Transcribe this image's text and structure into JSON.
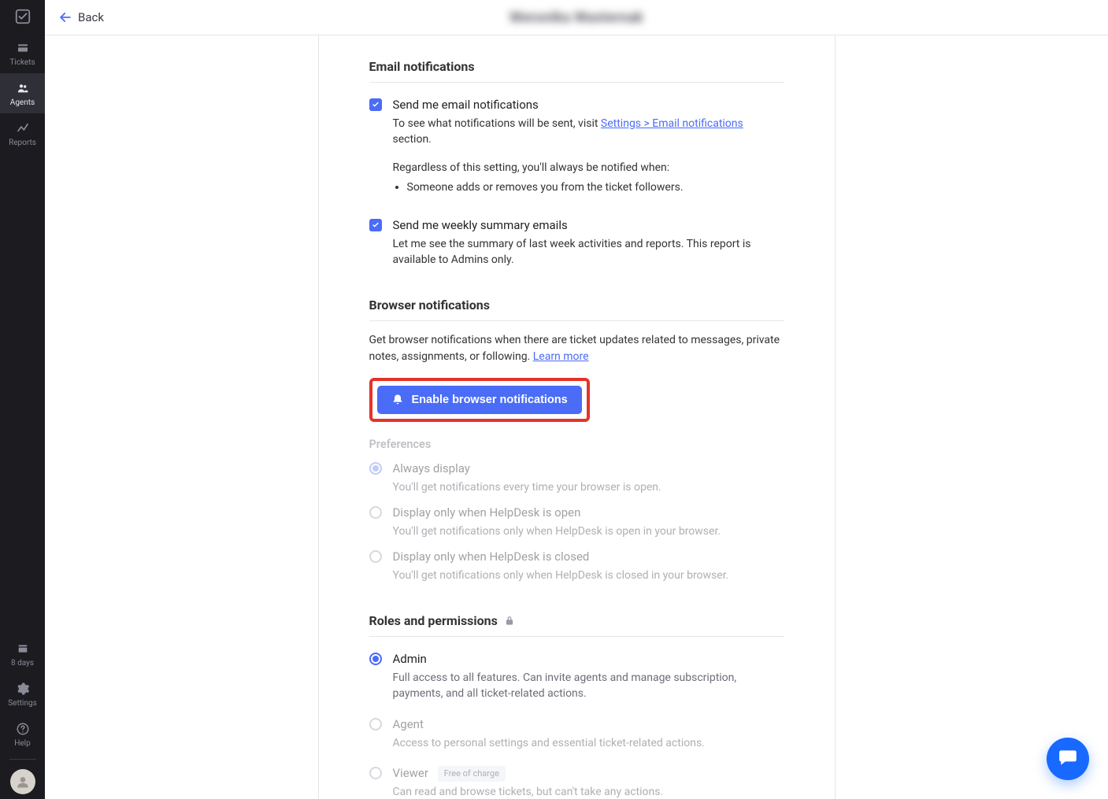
{
  "sidebar": {
    "top": [
      {
        "label": "Tickets",
        "icon": "tickets"
      },
      {
        "label": "Agents",
        "icon": "agents"
      },
      {
        "label": "Reports",
        "icon": "reports"
      }
    ],
    "bottom": [
      {
        "label": "8 days",
        "icon": "calendar"
      },
      {
        "label": "Settings",
        "icon": "gear"
      },
      {
        "label": "Help",
        "icon": "help"
      }
    ]
  },
  "topbar": {
    "back": "Back",
    "title": "Weronika Wasternak"
  },
  "sections": {
    "email": {
      "heading": "Email notifications",
      "send_email": {
        "label": "Send me email notifications",
        "help_prefix": "To see what notifications will be sent, visit ",
        "help_link": "Settings > Email notifications",
        "help_suffix": " section.",
        "always_prefix": "Regardless of this setting, you'll always be notified when:",
        "always_item": "Someone adds or removes you from the ticket followers."
      },
      "weekly": {
        "label": "Send me weekly summary emails",
        "desc": "Let me see the summary of last week activities and reports. This report is available to Admins only."
      }
    },
    "browser": {
      "heading": "Browser notifications",
      "intro_prefix": "Get browser notifications when there are ticket updates related to messages, private notes, assignments, or following. ",
      "learn_more": "Learn more",
      "enable_button": "Enable browser notifications",
      "prefs_heading": "Preferences",
      "options": [
        {
          "label": "Always display",
          "desc": "You'll get notifications every time your browser is open."
        },
        {
          "label": "Display only when HelpDesk is open",
          "desc": "You'll get notifications only when HelpDesk is open in your browser."
        },
        {
          "label": "Display only when HelpDesk is closed",
          "desc": "You'll get notifications only when HelpDesk is closed in your browser."
        }
      ]
    },
    "roles": {
      "heading": "Roles and permissions",
      "options": [
        {
          "label": "Admin",
          "desc": "Full access to all features. Can invite agents and manage subscription, payments, and all ticket-related actions."
        },
        {
          "label": "Agent",
          "desc": "Access to personal settings and essential ticket-related actions."
        },
        {
          "label": "Viewer",
          "badge": "Free of charge",
          "desc": "Can read and browse tickets, but can't take any actions."
        }
      ]
    }
  }
}
